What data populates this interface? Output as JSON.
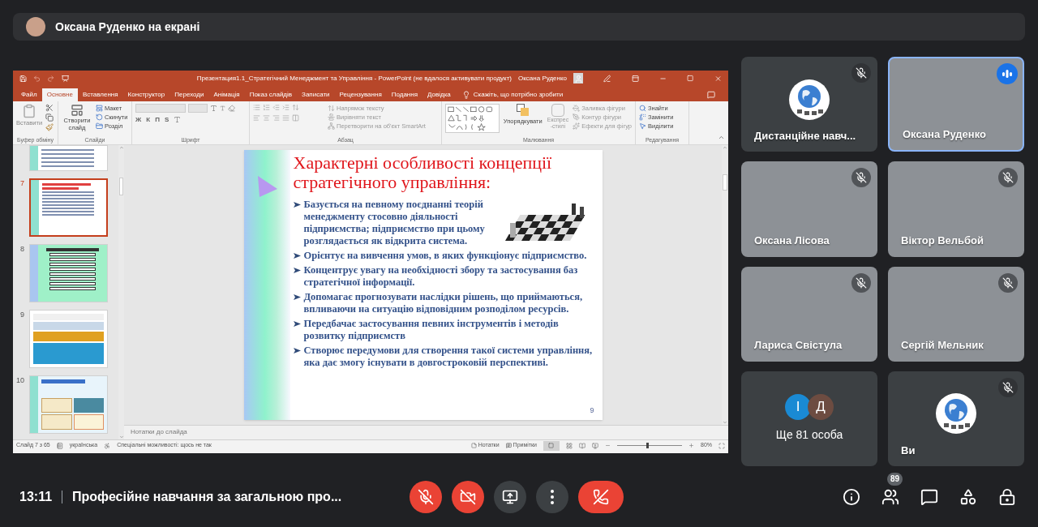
{
  "presenter_banner": {
    "text": "Оксана Руденко на екрані"
  },
  "powerpoint": {
    "title": "Презентация1.1_Стратегічний Менеджмент та Управління  -  PowerPoint (не вдалося активувати продукт)",
    "user": "Оксана Руденко",
    "tabs": [
      {
        "label": "Файл",
        "selected": false
      },
      {
        "label": "Основне",
        "selected": true
      },
      {
        "label": "Вставлення",
        "selected": false
      },
      {
        "label": "Конструктор",
        "selected": false
      },
      {
        "label": "Переходи",
        "selected": false
      },
      {
        "label": "Анімація",
        "selected": false
      },
      {
        "label": "Показ слайдів",
        "selected": false
      },
      {
        "label": "Записати",
        "selected": false
      },
      {
        "label": "Рецензування",
        "selected": false
      },
      {
        "label": "Подання",
        "selected": false
      },
      {
        "label": "Довідка",
        "selected": false
      }
    ],
    "tell_me": "Скажіть, що потрібно зробити",
    "ribbon": {
      "clipboard": {
        "label": "Буфер обміну",
        "paste": "Вставити"
      },
      "slides": {
        "label": "Слайди",
        "new_slide": "Створити слайд",
        "items": [
          "Макет",
          "Скинути",
          "Розділ"
        ]
      },
      "font": {
        "label": "Шрифт",
        "format_buttons": [
          "Ж",
          "К",
          "П",
          "S"
        ]
      },
      "paragraph": {
        "label": "Абзац",
        "items": [
          "Напрямок тексту",
          "Вирівняти текст",
          "Перетворити на об'єкт SmartArt"
        ]
      },
      "drawing": {
        "label": "Малювання",
        "arrange": "Упорядкувати",
        "quick_styles": "Експрес-стилі",
        "items": [
          "Заливка фігури",
          "Контур фігури",
          "Ефекти для фігур"
        ]
      },
      "editing": {
        "label": "Редагування",
        "items": [
          "Знайти",
          "Замінити",
          "Виділити"
        ]
      }
    },
    "thumbnails": [
      {
        "number": "7",
        "kind": "bullets",
        "selected": true
      },
      {
        "number": "8",
        "kind": "diagram",
        "selected": false
      },
      {
        "number": "9",
        "kind": "bands",
        "selected": false
      },
      {
        "number": "10",
        "kind": "mixed",
        "selected": false
      }
    ],
    "slide": {
      "title": "Характерні особливості концепції стратегічного управління:",
      "bullets": [
        "Базується на певному поєднанні теорій менеджменту стосовно діяльності підприємства; підприємство при цьому розглядається як відкрита система.",
        "Орієнтує на вивчення умов, в яких функціонує підприємство.",
        "Концентрує увагу на необхідності збору та застосування баз стратегічної інформації.",
        "Допомагає прогнозувати наслідки рішень, що приймаються, впливаючи на ситуацію відповідним розподілом ресурсів.",
        "Передбачає застосування певних інструментів і методів розвитку підприємств",
        "Створює передумови для створення такої системи управління, яка дає змогу існувати в довгостроковій перспективі."
      ],
      "page_number": "9"
    },
    "notes_placeholder": "Нотатки до слайда",
    "status_bar": {
      "slide": "Слайд 7 з 65",
      "language": "українська",
      "accessibility": "Спеціальні можливості: щось не так",
      "notes": "Нотатки",
      "comments": "Примітки",
      "zoom": {
        "level": 0.45,
        "reading": "80%"
      }
    }
  },
  "participants": [
    {
      "kind": "avatar",
      "name": "Дистанційне навч...",
      "muted": true,
      "speaking": false
    },
    {
      "kind": "video",
      "name": "Оксана Руденко",
      "muted": false,
      "speaking": true
    },
    {
      "kind": "video",
      "name": "Оксана Лісова",
      "muted": true,
      "speaking": false
    },
    {
      "kind": "video",
      "name": "Віктор Вельбой",
      "muted": true,
      "speaking": false
    },
    {
      "kind": "video",
      "name": "Лариса Свістула",
      "muted": true,
      "speaking": false
    },
    {
      "kind": "video",
      "name": "Сергій Мельник",
      "muted": true,
      "speaking": false
    },
    {
      "kind": "others",
      "text": "Ще 81 особа",
      "avatars": [
        {
          "letter": "І",
          "color": "#1a8ad4"
        },
        {
          "letter": "Д",
          "color": "#6d4c41"
        }
      ]
    },
    {
      "kind": "avatar",
      "name": "Ви",
      "muted": true,
      "speaking": false
    }
  ],
  "meeting": {
    "time": "13:11",
    "title": "Професійне навчання за загальною про..."
  },
  "controls": [
    {
      "kind": "mic",
      "on": false
    },
    {
      "kind": "camera",
      "on": false
    },
    {
      "kind": "present"
    },
    {
      "kind": "more"
    },
    {
      "kind": "hangup"
    }
  ],
  "side_controls": [
    {
      "kind": "info"
    },
    {
      "kind": "people",
      "badge": "89"
    },
    {
      "kind": "chat"
    },
    {
      "kind": "activities"
    },
    {
      "kind": "lock"
    }
  ]
}
